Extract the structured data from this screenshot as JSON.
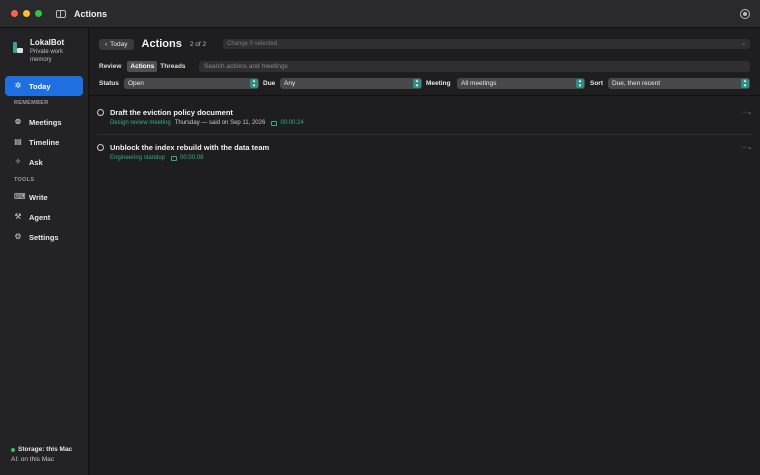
{
  "window": {
    "title": "Actions"
  },
  "brand": {
    "name": "LokalBot",
    "subtitle": "Private work memory"
  },
  "sidebar": {
    "today": {
      "label": "Today",
      "icon": "sun-icon"
    },
    "remember_label": "REMEMBER",
    "remember_items": [
      {
        "label": "Meetings",
        "icon": "meetings-icon"
      },
      {
        "label": "Timeline",
        "icon": "calendar-icon"
      },
      {
        "label": "Ask",
        "icon": "sparkle-icon"
      }
    ],
    "tools_label": "TOOLS",
    "tools_items": [
      {
        "label": "Write",
        "icon": "keyboard-icon"
      },
      {
        "label": "Agent",
        "icon": "wand-icon"
      },
      {
        "label": "Settings",
        "icon": "gear-icon"
      }
    ],
    "storage": "Storage: this Mac",
    "ai": "AI: on this Mac"
  },
  "header": {
    "back_label": "Today",
    "title": "Actions",
    "count": "2 of 2",
    "change_placeholder": "Change 0 selected"
  },
  "tabs": {
    "review": "Review",
    "actions": "Actions",
    "threads": "Threads"
  },
  "search": {
    "placeholder": "Search actions and meetings"
  },
  "filters": {
    "status_label": "Status",
    "status_value": "Open",
    "due_label": "Due",
    "due_value": "Any",
    "meeting_label": "Meeting",
    "meeting_value": "All meetings",
    "sort_label": "Sort",
    "sort_value": "Due, then recent"
  },
  "actions": [
    {
      "title": "Draft the eviction policy document",
      "meeting": "Design review meeting",
      "meta": "Thursday — said on Sep 11, 2026",
      "duration": "00:00:24"
    },
    {
      "title": "Unblock the index rebuild with the data team",
      "meeting": "Engineering standup",
      "meta": "",
      "duration": "00:00:08"
    }
  ],
  "colors": {
    "accent": "#1f6fe0",
    "teal": "#2fae8f",
    "background": "#1e1e20"
  }
}
